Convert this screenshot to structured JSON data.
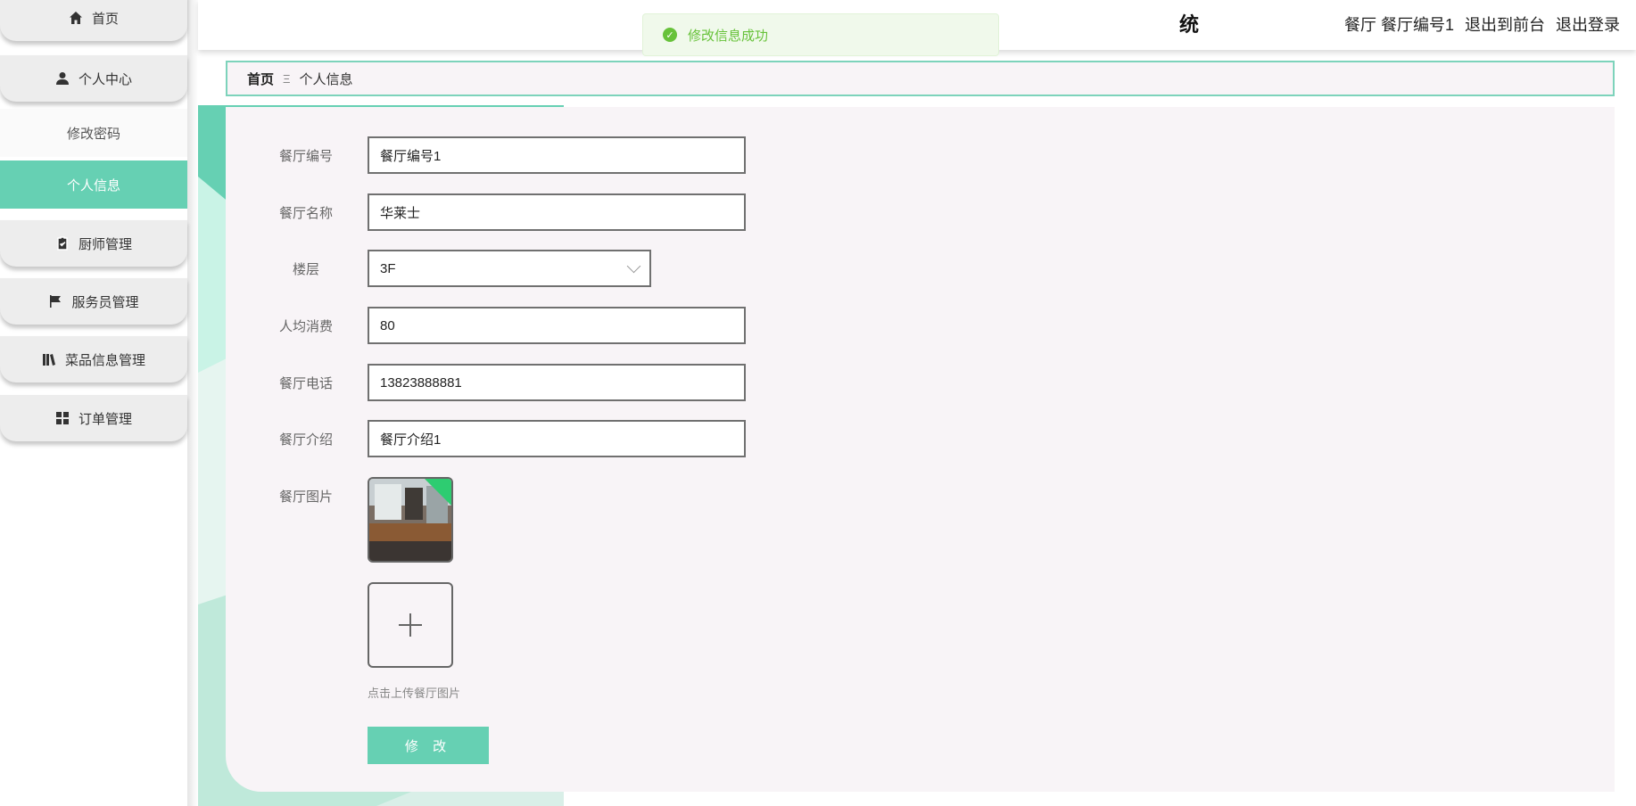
{
  "sidebar": {
    "items": [
      {
        "label": "首页",
        "icon": "home-icon"
      },
      {
        "label": "个人中心",
        "icon": "user-icon"
      },
      {
        "label": "修改密码"
      },
      {
        "label": "个人信息"
      },
      {
        "label": "厨师管理",
        "icon": "clipboard-check-icon"
      },
      {
        "label": "服务员管理",
        "icon": "flag-icon"
      },
      {
        "label": "菜品信息管理",
        "icon": "books-icon"
      },
      {
        "label": "订单管理",
        "icon": "grid-icon"
      }
    ]
  },
  "header": {
    "title_fragment": "统",
    "user_label": "餐厅 餐厅编号1",
    "to_front_label": "退出到前台",
    "logout_label": "退出登录"
  },
  "toast": {
    "message": "修改信息成功",
    "color": "#67c23a"
  },
  "breadcrumb": {
    "home": "首页",
    "separator": "Ξ",
    "current": "个人信息"
  },
  "form": {
    "restaurant_no": {
      "label": "餐厅编号",
      "value": "餐厅编号1"
    },
    "restaurant_name": {
      "label": "餐厅名称",
      "value": "华莱士"
    },
    "floor": {
      "label": "楼层",
      "value": "3F"
    },
    "avg_spend": {
      "label": "人均消费",
      "value": "80"
    },
    "phone": {
      "label": "餐厅电话",
      "value": "13823888881"
    },
    "intro": {
      "label": "餐厅介绍",
      "value": "餐厅介绍1"
    },
    "image": {
      "label": "餐厅图片",
      "upload_hint": "点击上传餐厅图片"
    },
    "submit_label": "修 改"
  },
  "colors": {
    "accent": "#66d0b3",
    "border": "#707070"
  }
}
